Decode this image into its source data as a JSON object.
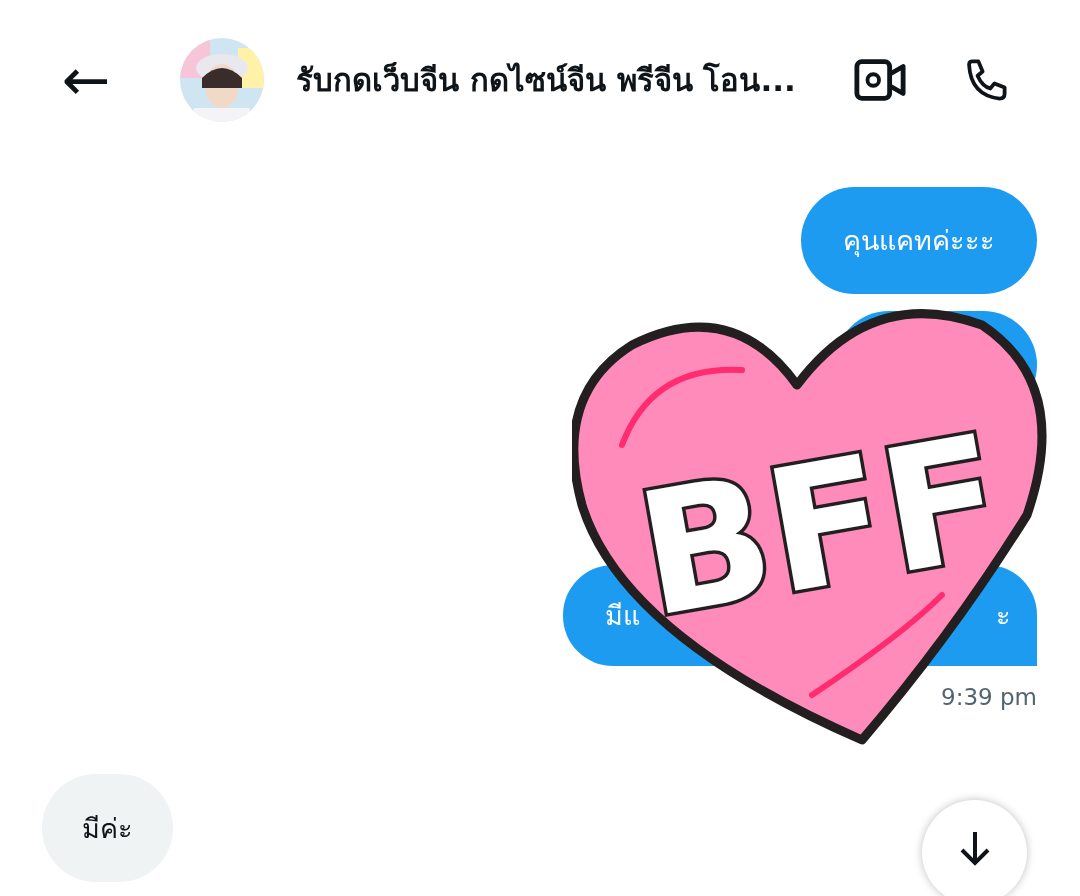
{
  "header": {
    "back": "←",
    "title": "รับกดเว็บจีน กดไซน์จีน พรีจีน โอน..."
  },
  "messages": [
    {
      "kind": "sent",
      "text": "คุนแคทค่ะะะ"
    },
    {
      "kind": "covered"
    },
    {
      "kind": "sent_covered",
      "start": "มีแ",
      "end": "ะ"
    }
  ],
  "sticker": {
    "text": "BFF"
  },
  "time": "9:39 pm",
  "received": [
    {
      "text": "มีค่ะ"
    }
  ]
}
